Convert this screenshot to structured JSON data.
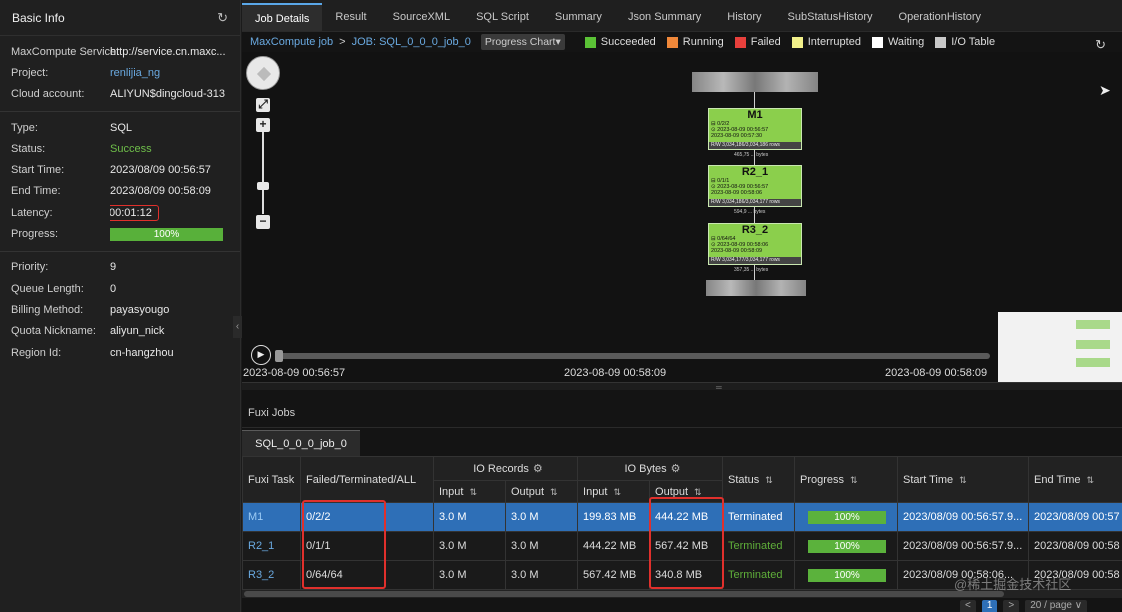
{
  "basic_info": {
    "title": "Basic Info",
    "group1": [
      {
        "label": "MaxCompute Service:",
        "value": "http://service.cn.maxc..."
      },
      {
        "label": "Project:",
        "value": "renlijia_ng"
      },
      {
        "label": "Cloud account:",
        "value": "ALIYUN$dingcloud-313"
      }
    ],
    "group2": [
      {
        "label": "Type:",
        "value": "SQL"
      },
      {
        "label": "Status:",
        "value": "Success"
      },
      {
        "label": "Start Time:",
        "value": "2023/08/09 00:56:57"
      },
      {
        "label": "End Time:",
        "value": "2023/08/09 00:58:09"
      },
      {
        "label": "Latency:",
        "value": "00:01:12"
      },
      {
        "label": "Progress:",
        "value": "100%"
      }
    ],
    "group3": [
      {
        "label": "Priority:",
        "value": "9"
      },
      {
        "label": "Queue Length:",
        "value": "0"
      },
      {
        "label": "Billing Method:",
        "value": "payasyougo"
      },
      {
        "label": "Quota Nickname:",
        "value": "aliyun_nick"
      },
      {
        "label": "Region Id:",
        "value": "cn-hangzhou"
      }
    ],
    "progress_value": 1.0
  },
  "tabs": [
    "Job Details",
    "Result",
    "SourceXML",
    "SQL Script",
    "Summary",
    "Json Summary",
    "History",
    "SubStatusHistory",
    "OperationHistory"
  ],
  "active_tab": "Job Details",
  "breadcrumb": {
    "root": "MaxCompute job",
    "sep": ">",
    "job": "JOB: SQL_0_0_0_job_0",
    "view_select": "Progress Chart▾"
  },
  "legend": [
    {
      "label": "Succeeded",
      "color": "#5bc236"
    },
    {
      "label": "Running",
      "color": "#f0883a"
    },
    {
      "label": "Failed",
      "color": "#e8403c"
    },
    {
      "label": "Interrupted",
      "color": "#f2f08a"
    },
    {
      "label": "Waiting",
      "color": "#ffffff"
    },
    {
      "label": "I/O Table",
      "color": "#c8c8c8"
    }
  ],
  "graph": {
    "nodes": [
      {
        "name": "M1",
        "l1": "⊟ 0/2/2",
        "l2": "⊙ 2023-08-09 00:56:57",
        "l3": "   2023-08-09 00:57:30",
        "rw": "R/W      3,034,186/3,034,186 rows",
        "edge": "465,75 ... bytes"
      },
      {
        "name": "R2_1",
        "l1": "⊟ 0/1/1",
        "l2": "⊙ 2023-08-09 00:56:57",
        "l3": "   2023-08-09 00:58:06",
        "rw": "R/W      3,034,186/3,034,177 rows",
        "edge": "594,9 ... bytes"
      },
      {
        "name": "R3_2",
        "l1": "⊟ 0/64/64",
        "l2": "⊙ 2023-08-09 00:58:06",
        "l3": "   2023-08-09 00:58:09",
        "rw": "R/W      3,034,177/3,034,177 rows",
        "edge": "357,35 ... bytes"
      }
    ]
  },
  "timeline": {
    "start": "2023-08-09 00:56:57",
    "mid": "2023-08-09 00:58:09",
    "end": "2023-08-09 00:58:09"
  },
  "fuxi": {
    "section_title": "Fuxi Jobs",
    "job_tab": "SQL_0_0_0_job_0",
    "headers": {
      "task": "Fuxi Task",
      "ftall": "Failed/Terminated/ALL",
      "io_records": "IO Records",
      "io_bytes": "IO Bytes",
      "input": "Input",
      "output": "Output",
      "status": "Status",
      "progress": "Progress",
      "start": "Start Time",
      "end": "End Time"
    },
    "rows": [
      {
        "task": "M1",
        "fta": "0/2/2",
        "rin": "3.0 M",
        "rout": "3.0 M",
        "bin": "199.83 MB",
        "bout": "444.22 MB",
        "status": "Terminated",
        "progress": "100%",
        "start": "2023/08/09 00:56:57.9...",
        "end": "2023/08/09 00:57"
      },
      {
        "task": "R2_1",
        "fta": "0/1/1",
        "rin": "3.0 M",
        "rout": "3.0 M",
        "bin": "444.22 MB",
        "bout": "567.42 MB",
        "status": "Terminated",
        "progress": "100%",
        "start": "2023/08/09 00:56:57.9...",
        "end": "2023/08/09 00:58"
      },
      {
        "task": "R3_2",
        "fta": "0/64/64",
        "rin": "3.0 M",
        "rout": "3.0 M",
        "bin": "567.42 MB",
        "bout": "340.8 MB",
        "status": "Terminated",
        "progress": "100%",
        "start": "2023/08/09 00:58:06...",
        "end": "2023/08/09 00:58"
      }
    ],
    "pager": {
      "prev": "<",
      "page": "1",
      "next": ">",
      "size": "20 / page ∨"
    }
  },
  "watermark": "@稀土掘金技术社区"
}
